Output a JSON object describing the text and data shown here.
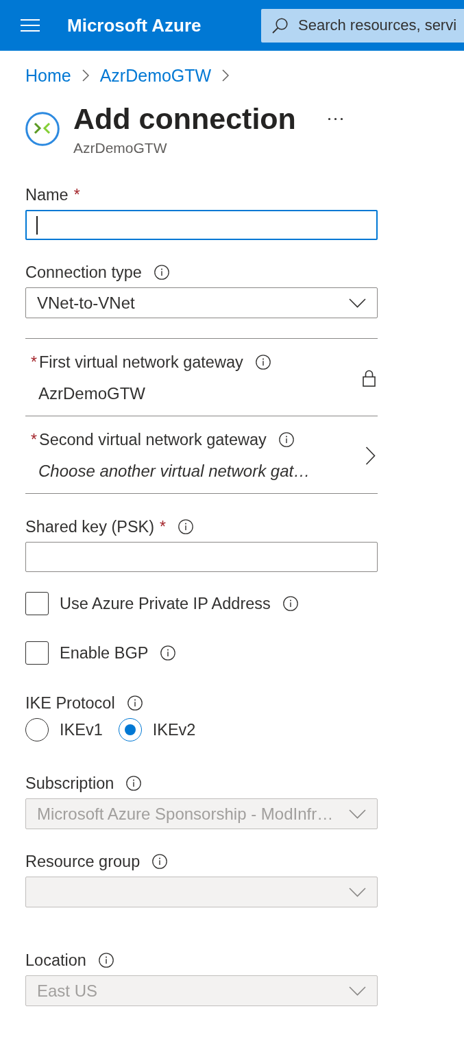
{
  "header": {
    "title": "Microsoft Azure",
    "search": {
      "placeholder": "Search resources, servi"
    }
  },
  "breadcrumb": [
    {
      "label": "Home"
    },
    {
      "label": "AzrDemoGTW"
    }
  ],
  "page": {
    "title": "Add connection",
    "subtitle": "AzrDemoGTW"
  },
  "form": {
    "fields": [
      {
        "kind": "text",
        "label": "Name",
        "required_mark": "*",
        "focused": true
      },
      {
        "kind": "dropdown",
        "label": "Connection type",
        "info": true,
        "value": "VNet-to-VNet",
        "disabled": false
      },
      {
        "kind": "gateway",
        "label": "First virtual network gateway",
        "required_mark": "*",
        "info": true,
        "value": "AzrDemoGTW",
        "locked": true
      },
      {
        "kind": "gateway",
        "label": "Second virtual network gateway",
        "required_mark": "*",
        "info": true,
        "placeholder": "Choose another virtual network gat…",
        "locked": false
      },
      {
        "kind": "text",
        "label": "Shared key (PSK)",
        "required_mark": "*",
        "info": true,
        "focused": false
      },
      {
        "kind": "checkbox",
        "label": "Use Azure Private IP Address",
        "info": true,
        "checked": false
      },
      {
        "kind": "checkbox",
        "label": "Enable BGP",
        "info": true,
        "checked": false
      },
      {
        "kind": "radio_group",
        "label": "IKE Protocol",
        "info": true,
        "options": [
          {
            "label": "IKEv1",
            "selected": false
          },
          {
            "label": "IKEv2",
            "selected": true
          }
        ]
      },
      {
        "kind": "dropdown",
        "label": "Subscription",
        "info": true,
        "value": "Microsoft Azure Sponsorship - ModInfr…",
        "disabled": true
      },
      {
        "kind": "dropdown",
        "label": "Resource group",
        "info": true,
        "disabled": true
      },
      {
        "kind": "dropdown",
        "label": "Location",
        "info": true,
        "value": "East US",
        "disabled": true
      }
    ]
  }
}
